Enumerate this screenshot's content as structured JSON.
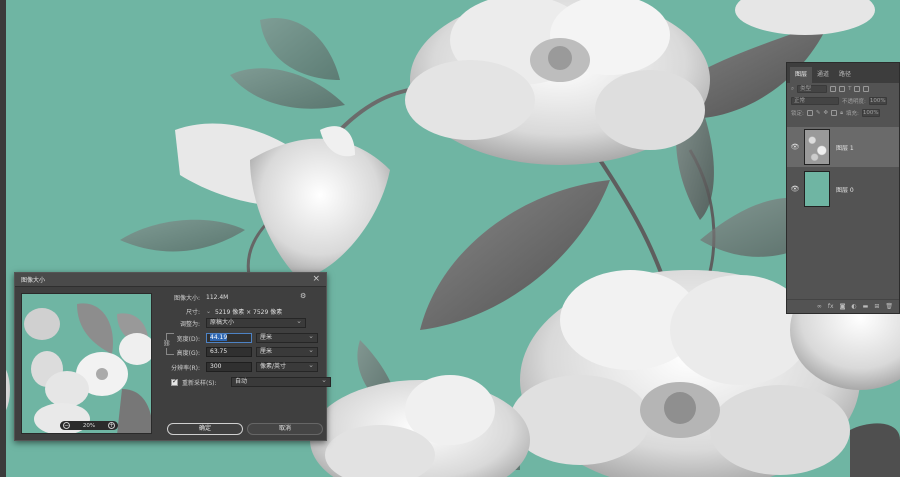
{
  "layers_panel": {
    "tabs": [
      "图层",
      "通道",
      "路径"
    ],
    "filter_label": "类型",
    "blend_mode": "正常",
    "opacity_label": "不透明度:",
    "opacity_value": "100%",
    "lock_label": "锁定:",
    "fill_label": "填充:",
    "fill_value": "100%",
    "layers": [
      {
        "name": "图层 1",
        "selected": true,
        "visible": true
      },
      {
        "name": "图层 0",
        "selected": false,
        "visible": true
      }
    ],
    "footer_icons": [
      "link-icon",
      "fx-icon",
      "mask-icon",
      "adjustment-icon",
      "folder-icon",
      "new-layer-icon",
      "trash-icon"
    ]
  },
  "dialog": {
    "title": "图像大小",
    "close_symbol": "×",
    "image_size_label": "图像大小:",
    "image_size_value": "112.4M",
    "dimensions_label": "尺寸:",
    "dimensions_value": "5219 像素 × 7529 像素",
    "fit_label": "调整为:",
    "fit_value": "原稿大小",
    "width_label": "宽度(D):",
    "width_value": "44.19",
    "width_unit": "厘米",
    "height_label": "高度(G):",
    "height_value": "63.75",
    "height_unit": "厘米",
    "resolution_label": "分辨率(R):",
    "resolution_value": "300",
    "resolution_unit": "像素/英寸",
    "resample_label": "重新采样(S):",
    "resample_value": "自动",
    "resample_checked": true,
    "zoom_value": "20%",
    "ok_label": "确定",
    "cancel_label": "取消"
  },
  "colors": {
    "canvas_bg": "#6fb5a3",
    "panel_bg": "#535353",
    "dialog_bg": "#3f3f3f",
    "highlight": "#2f67b2"
  }
}
